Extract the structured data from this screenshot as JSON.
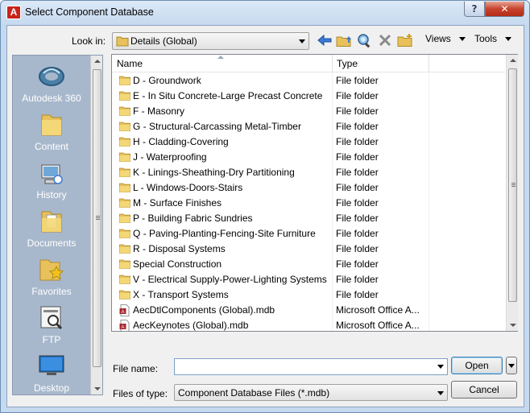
{
  "window": {
    "title": "Select Component Database",
    "help_label": "?",
    "close_label": "✕",
    "app_icon_letter": "A"
  },
  "toolbar": {
    "look_in_label": "Look in:",
    "look_in_value": "Details (Global)",
    "views_label": "Views",
    "tools_label": "Tools"
  },
  "places": [
    {
      "label": "Autodesk 360",
      "icon": "autodesk-360-icon"
    },
    {
      "label": "Content",
      "icon": "folder-icon"
    },
    {
      "label": "History",
      "icon": "history-icon"
    },
    {
      "label": "Documents",
      "icon": "documents-icon"
    },
    {
      "label": "Favorites",
      "icon": "favorites-icon"
    },
    {
      "label": "FTP",
      "icon": "ftp-icon"
    },
    {
      "label": "Desktop",
      "icon": "desktop-icon"
    }
  ],
  "list": {
    "columns": {
      "name": "Name",
      "type": "Type"
    },
    "rows": [
      {
        "name": "D - Groundwork",
        "type": "File folder",
        "kind": "folder"
      },
      {
        "name": "E - In Situ Concrete-Large Precast Concrete",
        "type": "File folder",
        "kind": "folder"
      },
      {
        "name": "F - Masonry",
        "type": "File folder",
        "kind": "folder"
      },
      {
        "name": "G - Structural-Carcassing Metal-Timber",
        "type": "File folder",
        "kind": "folder"
      },
      {
        "name": "H - Cladding-Covering",
        "type": "File folder",
        "kind": "folder"
      },
      {
        "name": "J - Waterproofing",
        "type": "File folder",
        "kind": "folder"
      },
      {
        "name": "K - Linings-Sheathing-Dry Partitioning",
        "type": "File folder",
        "kind": "folder"
      },
      {
        "name": "L - Windows-Doors-Stairs",
        "type": "File folder",
        "kind": "folder"
      },
      {
        "name": "M - Surface Finishes",
        "type": "File folder",
        "kind": "folder"
      },
      {
        "name": "P - Building Fabric Sundries",
        "type": "File folder",
        "kind": "folder"
      },
      {
        "name": "Q - Paving-Planting-Fencing-Site Furniture",
        "type": "File folder",
        "kind": "folder"
      },
      {
        "name": "R - Disposal Systems",
        "type": "File folder",
        "kind": "folder"
      },
      {
        "name": "Special Construction",
        "type": "File folder",
        "kind": "folder"
      },
      {
        "name": "V - Electrical Supply-Power-Lighting Systems",
        "type": "File folder",
        "kind": "folder"
      },
      {
        "name": "X - Transport Systems",
        "type": "File folder",
        "kind": "folder"
      },
      {
        "name": "AecDtlComponents (Global).mdb",
        "type": "Microsoft Office A...",
        "kind": "mdb"
      },
      {
        "name": "AecKeynotes (Global).mdb",
        "type": "Microsoft Office A...",
        "kind": "mdb"
      }
    ]
  },
  "bottom": {
    "file_name_label": "File name:",
    "file_name_value": "",
    "files_of_type_label": "Files of type:",
    "files_of_type_value": "Component Database Files (*.mdb)",
    "open_label": "Open",
    "cancel_label": "Cancel"
  },
  "colors": {
    "places_bg": "#a8b8cc",
    "folder_yellow": "#e8c15a",
    "close_red": "#c7432d"
  }
}
